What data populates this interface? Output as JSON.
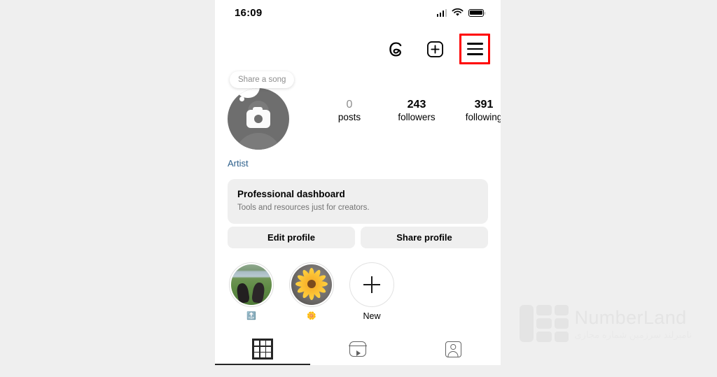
{
  "status_bar": {
    "time": "16:09",
    "icons": [
      "cellular-signal",
      "wifi",
      "battery"
    ]
  },
  "top_actions": {
    "threads_label": "Threads",
    "new_post_label": "New post",
    "menu_label": "Menu",
    "highlight_color": "#ff0000"
  },
  "profile": {
    "song_tooltip": "Share a song",
    "avatar_label": "Profile photo",
    "category": "Artist",
    "category_color": "#2d5f8b",
    "stats": [
      {
        "value": "0",
        "label": "posts",
        "dim": true
      },
      {
        "value": "243",
        "label": "followers",
        "dim": false
      },
      {
        "value": "391",
        "label": "following",
        "dim": false
      }
    ]
  },
  "dashboard": {
    "title": "Professional dashboard",
    "subtitle": "Tools and resources just for creators."
  },
  "profile_buttons": [
    {
      "label": "Edit profile"
    },
    {
      "label": "Share profile"
    }
  ],
  "highlights": [
    {
      "label": "🔝",
      "image": "feet-on-grass-photo"
    },
    {
      "label": "🌼",
      "image": "yellow-flower-photo"
    },
    {
      "label": "New",
      "image": "plus-icon"
    }
  ],
  "tabs": [
    {
      "name": "grid",
      "icon": "grid-icon",
      "active": true
    },
    {
      "name": "reels",
      "icon": "reels-icon",
      "active": false
    },
    {
      "name": "tagged",
      "icon": "tagged-icon",
      "active": false
    }
  ],
  "watermark": {
    "name": "NumberLand",
    "tagline": "نامبرلند سرزمین شماره مجازی"
  }
}
